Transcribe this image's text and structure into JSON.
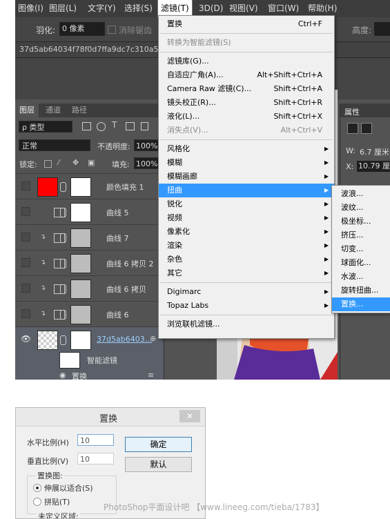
{
  "menubar": [
    "图像(I)",
    "图层(L)",
    "文字(Y)",
    "选择(S)",
    "滤镜(T)",
    "3D(D)",
    "视图(V)",
    "窗口(W)",
    "帮助(H)"
  ],
  "options": {
    "feather_label": "羽化:",
    "feather_value": "0 像素",
    "antialias_label": "消除锯齿",
    "height_label": "高度:"
  },
  "document_tab": "37d5ab64034f78f0d7ffa9dc7c310a55b2",
  "layers_panel": {
    "tabs": [
      "图层",
      "通道",
      "路径"
    ],
    "kind_filter": "ρ 类型",
    "blend_mode": "正常",
    "opacity_label": "不透明度:",
    "opacity_value": "100%",
    "lock_label": "锁定:",
    "fill_label": "填充:",
    "fill_value": "100%",
    "layers": [
      {
        "name": "颜色填充 1",
        "thumb": "#ff0000"
      },
      {
        "name": "曲线 5",
        "thumb": "#ffffff"
      },
      {
        "name": "曲线 7",
        "thumb": "photo"
      },
      {
        "name": "曲线 6 拷贝 2",
        "thumb": "photo"
      },
      {
        "name": "曲线 6 拷贝",
        "thumb": "photo"
      },
      {
        "name": "曲线 6",
        "thumb": "photo"
      },
      {
        "name": "37d5ab6403...",
        "thumb": "checker"
      }
    ],
    "smart_filters_label": "智能滤镜",
    "smart_filter_item": "置换"
  },
  "properties_panel": {
    "title": "属性",
    "w_label": "W:",
    "w_value": "6.7 厘米",
    "x_label": "X:",
    "x_value": "10.79 厘"
  },
  "filter_menu": {
    "items": [
      {
        "label": "置换",
        "shortcut": "Ctrl+F"
      },
      {
        "sep": true
      },
      {
        "label": "转换为智能滤镜(S)",
        "disabled": true
      },
      {
        "sep": true
      },
      {
        "label": "滤镜库(G)..."
      },
      {
        "label": "自适应广角(A)...",
        "shortcut": "Alt+Shift+Ctrl+A"
      },
      {
        "label": "Camera Raw 滤镜(C)...",
        "shortcut": "Shift+Ctrl+A"
      },
      {
        "label": "镜头校正(R)...",
        "shortcut": "Shift+Ctrl+R"
      },
      {
        "label": "液化(L)...",
        "shortcut": "Shift+Ctrl+X"
      },
      {
        "label": "消失点(V)...",
        "shortcut": "Alt+Ctrl+V",
        "disabled": true
      },
      {
        "sep": true
      },
      {
        "label": "风格化",
        "submenu": true
      },
      {
        "label": "模糊",
        "submenu": true
      },
      {
        "label": "模糊画廊",
        "submenu": true
      },
      {
        "label": "扭曲",
        "submenu": true,
        "highlight": true
      },
      {
        "label": "锐化",
        "submenu": true
      },
      {
        "label": "视频",
        "submenu": true
      },
      {
        "label": "像素化",
        "submenu": true
      },
      {
        "label": "渲染",
        "submenu": true
      },
      {
        "label": "杂色",
        "submenu": true
      },
      {
        "label": "其它",
        "submenu": true
      },
      {
        "sep": true
      },
      {
        "label": "Digimarc",
        "submenu": true
      },
      {
        "label": "Topaz Labs",
        "submenu": true
      },
      {
        "sep": true
      },
      {
        "label": "浏览联机滤镜..."
      }
    ]
  },
  "distort_submenu": [
    "波浪...",
    "波纹...",
    "极坐标...",
    "挤压...",
    "切变...",
    "球面化...",
    "水波...",
    "旋转扭曲...",
    "置换..."
  ],
  "dialog": {
    "title": "置换",
    "close": "✕",
    "horizontal_label": "水平比例(H)",
    "horizontal_value": "10",
    "vertical_label": "垂直比例(V)",
    "vertical_value": "10",
    "ok_label": "确定",
    "default_label": "默认",
    "map_group_label": "置换图:",
    "stretch_label": "伸展以适合(S)",
    "tile_label": "拼贴(T)",
    "undefined_label": "未定义区域:"
  },
  "watermark": "PhotoShop平面设计吧 【www.lineeg.com/tieba/1783】"
}
